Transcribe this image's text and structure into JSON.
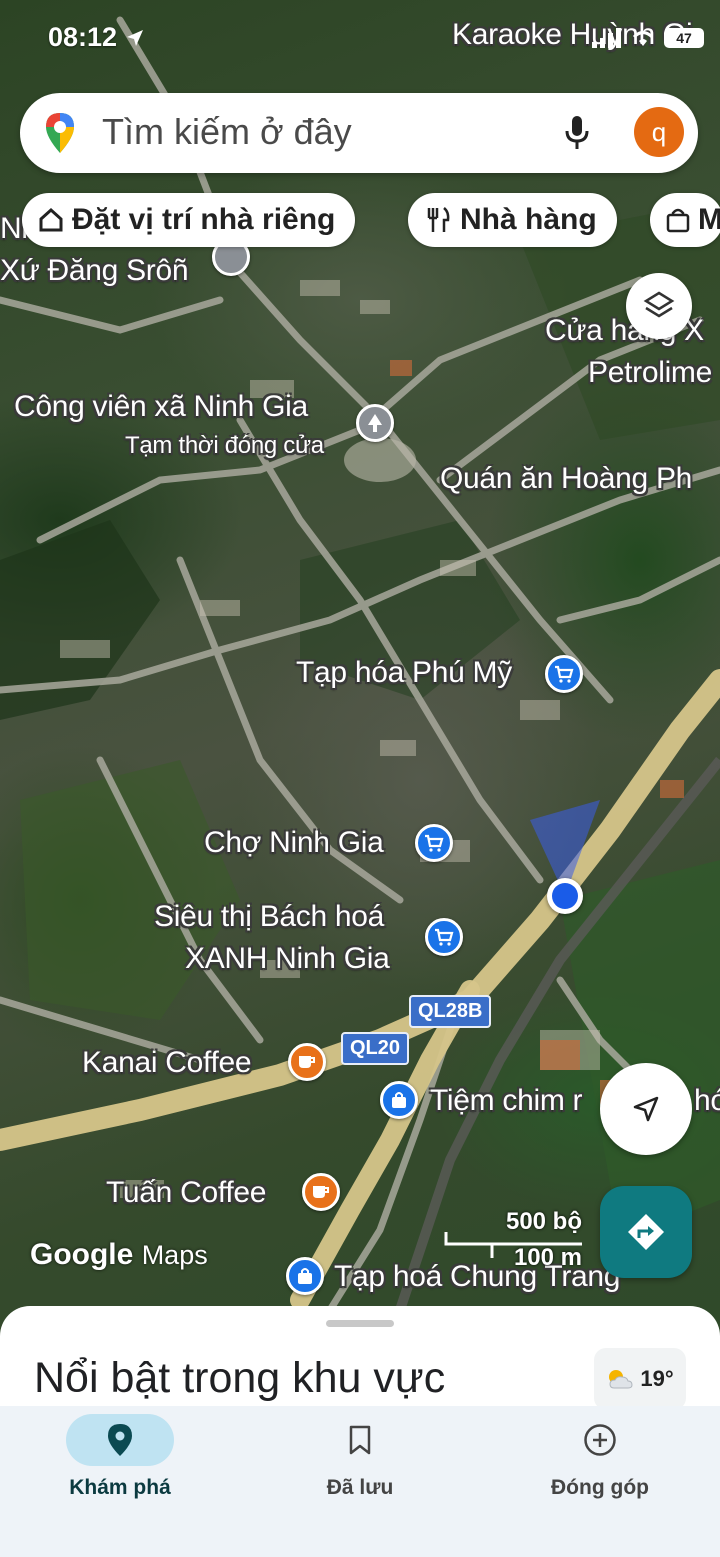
{
  "status_bar": {
    "time": "08:12",
    "battery": "47"
  },
  "search": {
    "placeholder": "Tìm kiếm ở đây",
    "avatar_letter": "q"
  },
  "chips": [
    {
      "label": "Đặt vị trí nhà riêng",
      "icon": "home-icon"
    },
    {
      "label": "Nhà hàng",
      "icon": "restaurant-icon"
    },
    {
      "label": "M",
      "icon": "shopping-bag-icon"
    }
  ],
  "map": {
    "labels": {
      "karaoke": "Karaoke Huỳnh Gi",
      "xu_dang": "Xứ Đăng Srôñ",
      "ni": "Ni",
      "cua_hang": "Cửa hàng X",
      "petrolimex": "Petrolime",
      "cong_vien": "Công viên xã Ninh Gia",
      "cong_vien_status": "Tạm thời đóng cửa",
      "quan_an": "Quán ăn Hoàng Ph",
      "tap_hoa_phu_my": "Tạp hóa Phú Mỹ",
      "cho_ninh_gia": "Chợ Ninh Gia",
      "sieu_thi_1": "Siêu thị Bách hoá",
      "sieu_thi_2": "XANH Ninh Gia",
      "kanai": "Kanai Coffee",
      "tiem_chim": "Tiệm chim r",
      "tiem_chim_end": "hó",
      "tuan": "Tuấn Coffee",
      "tap_hoa_chung": "Tạp hoá Chung Trang"
    },
    "road_shields": {
      "ql28b": "QL28B",
      "ql20": "QL20"
    },
    "scale": {
      "imperial": "500 bộ",
      "metric": "100 m"
    },
    "watermark": {
      "google": "Google",
      "maps": "Maps"
    }
  },
  "sheet": {
    "title": "Nổi bật trong khu vực",
    "temperature": "19°"
  },
  "nav": [
    {
      "label": "Khám phá",
      "icon": "location-pin-icon",
      "active": true
    },
    {
      "label": "Đã lưu",
      "icon": "bookmark-icon",
      "active": false
    },
    {
      "label": "Đóng góp",
      "icon": "add-circle-icon",
      "active": false
    }
  ]
}
